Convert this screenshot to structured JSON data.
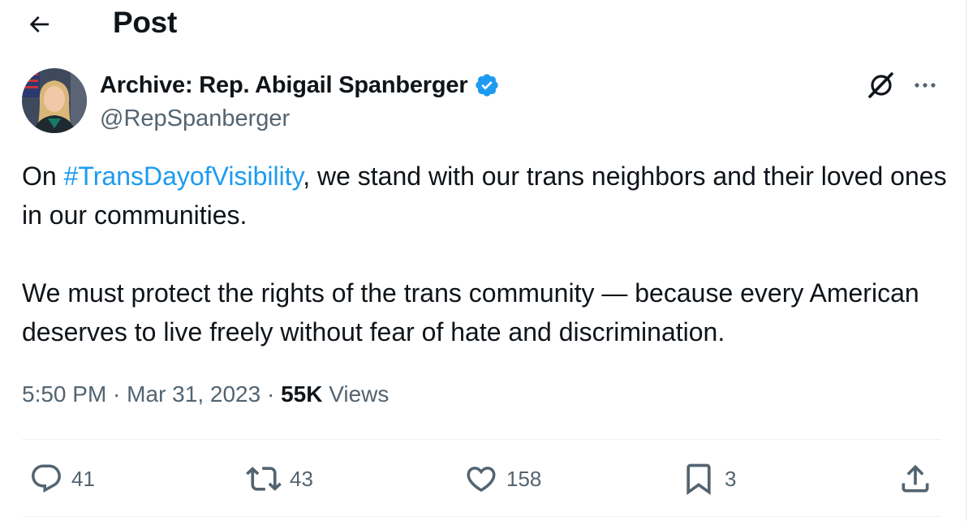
{
  "header": {
    "back_icon": "arrow-left-icon",
    "title": "Post"
  },
  "author": {
    "name": "Archive: Rep. Abigail Spanberger",
    "handle": "@RepSpanberger",
    "verified_icon": "verified-badge-icon",
    "verified_color": "#1d9bf0"
  },
  "post": {
    "text_prefix": "On ",
    "hashtag": "#TransDayofVisibility",
    "text_line1_suffix": ", we stand with our trans neighbors and their loved ones in our communities.",
    "paragraph2": "We must protect the rights of the trans community — because every American deserves to live freely without fear of hate and discrimination.",
    "hashtag_color": "#1d9bf0"
  },
  "meta": {
    "time": "5:50 PM",
    "separator": " · ",
    "date": "Mar 31, 2023",
    "views_count": "55K",
    "views_label": "Views"
  },
  "actions": {
    "replies": "41",
    "reposts": "43",
    "likes": "158",
    "bookmarks": "3",
    "reply_icon": "reply-bubble-icon",
    "repost_icon": "repost-icon",
    "like_icon": "heart-icon",
    "bookmark_icon": "bookmark-icon",
    "share_icon": "share-upload-icon"
  },
  "colors": {
    "text_primary": "#0f1419",
    "text_secondary": "#536471",
    "accent": "#1d9bf0",
    "divider": "#eff3f4"
  }
}
